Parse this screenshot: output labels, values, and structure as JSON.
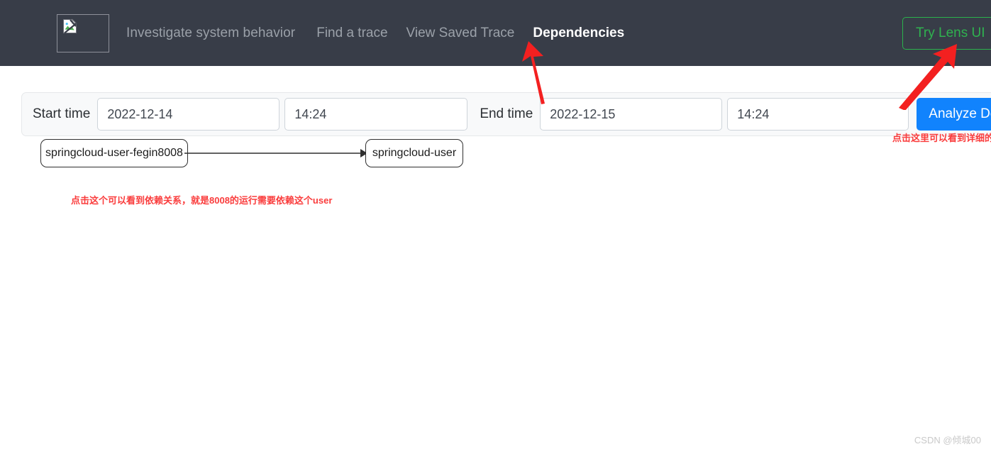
{
  "header": {
    "logo_icon": "broken-image-icon",
    "brand_title": "Investigate system behavior",
    "nav": [
      {
        "label": "Find a trace",
        "active": false
      },
      {
        "label": "View Saved Trace",
        "active": false
      },
      {
        "label": "Dependencies",
        "active": true
      }
    ],
    "lens_button": "Try Lens UI",
    "background_color": "#383d48",
    "lens_button_color": "#2fb24f"
  },
  "search_form": {
    "start_label": "Start time",
    "start_date": "2022-12-14",
    "start_time": "14:24",
    "end_label": "End time",
    "end_date": "2022-12-15",
    "end_time": "14:24",
    "analyze_button": "Analyze Dependencies",
    "panel_color": "#f8f9fa",
    "button_color": "#1183fd"
  },
  "graph": {
    "nodes": [
      {
        "id": "a",
        "label": "springcloud-user-fegin8008"
      },
      {
        "id": "b",
        "label": "springcloud-user"
      }
    ],
    "edges": [
      {
        "from": "a",
        "to": "b"
      }
    ]
  },
  "annotations": {
    "graph_note": "点击这个可以看到依赖关系，就是8008的运行需要依赖这个user",
    "top_note": "点击这里可以看到详细的",
    "color": "#fa3c3c",
    "arrows": [
      {
        "name": "arrow-to-dependencies-tab"
      },
      {
        "name": "arrow-to-try-lens-ui"
      }
    ]
  },
  "watermark": "CSDN @倾城00"
}
